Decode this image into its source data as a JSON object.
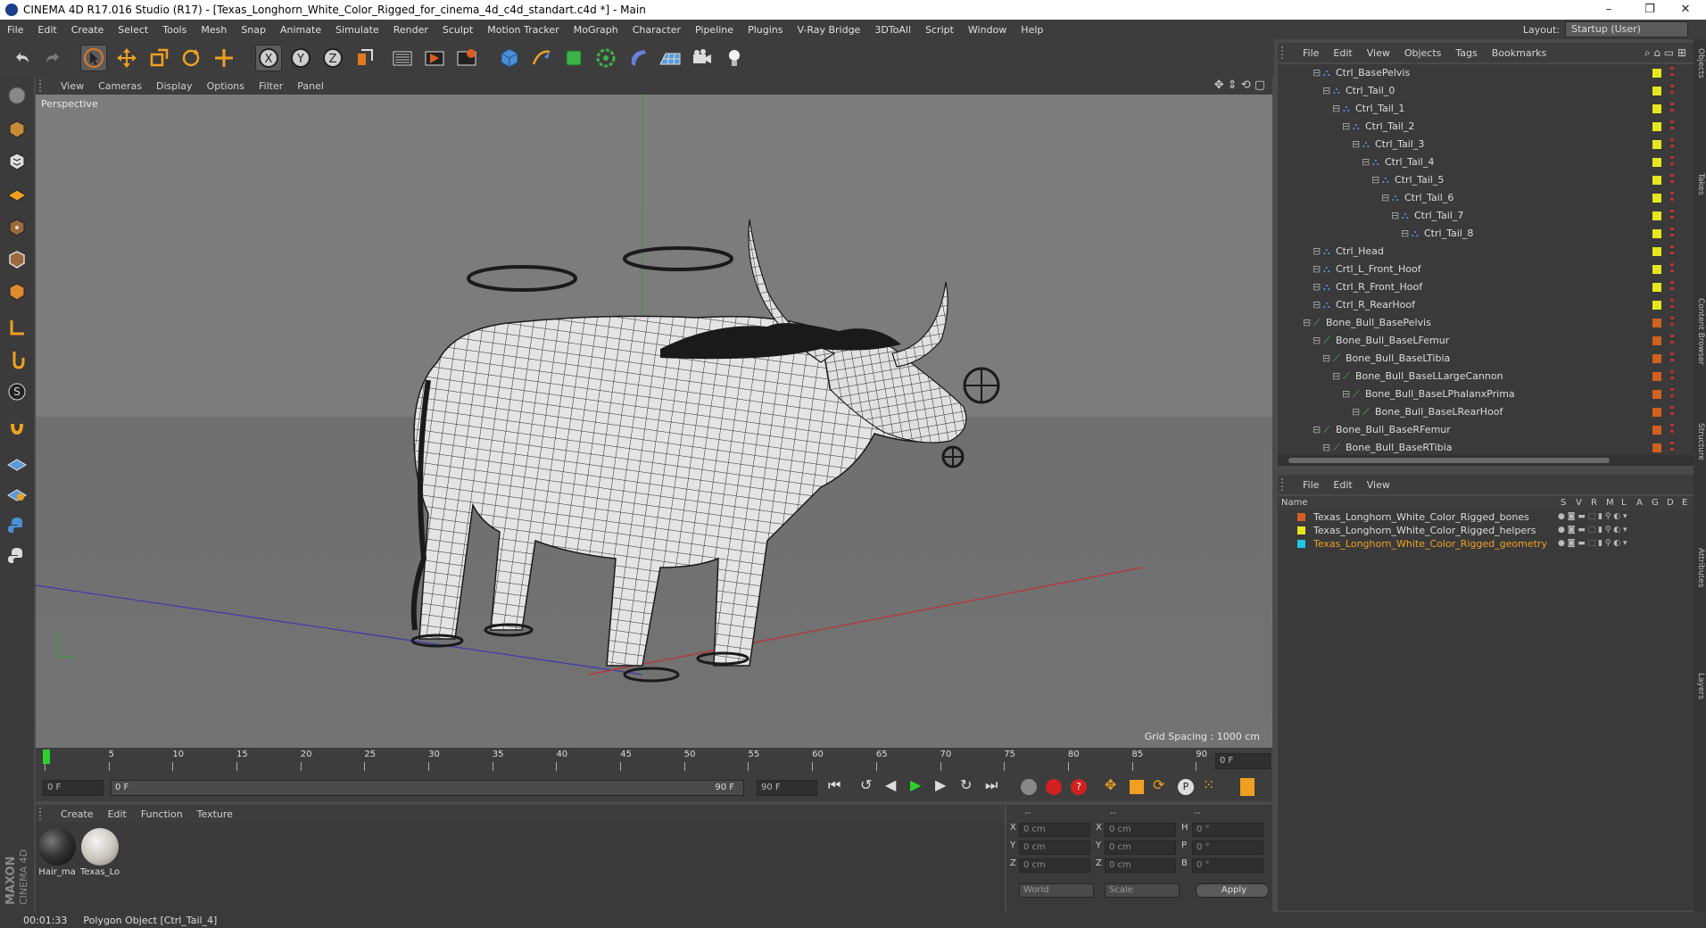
{
  "window": {
    "title": "CINEMA 4D R17.016 Studio (R17) - [Texas_Longhorn_White_Color_Rigged_for_cinema_4d_c4d_standart.c4d *] - Main",
    "controls": [
      "–",
      "❐",
      "✕"
    ]
  },
  "menubar": {
    "items": [
      "File",
      "Edit",
      "Create",
      "Select",
      "Tools",
      "Mesh",
      "Snap",
      "Animate",
      "Simulate",
      "Render",
      "Sculpt",
      "Motion Tracker",
      "MoGraph",
      "Character",
      "Pipeline",
      "Plugins",
      "V-Ray Bridge",
      "3DToAll",
      "Script",
      "Window",
      "Help"
    ],
    "layout_label": "Layout:",
    "layout_value": "Startup (User)"
  },
  "viewport": {
    "menu": [
      "View",
      "Cameras",
      "Display",
      "Options",
      "Filter",
      "Panel"
    ],
    "label": "Perspective",
    "grid_spacing": "Grid Spacing : 1000 cm"
  },
  "timeline": {
    "ticks": [
      "0",
      "5",
      "10",
      "15",
      "20",
      "25",
      "30",
      "35",
      "40",
      "45",
      "50",
      "55",
      "60",
      "65",
      "70",
      "75",
      "80",
      "85",
      "90"
    ],
    "current_frame": "0 F",
    "start_field": "0 F",
    "range_start": "0 F",
    "range_end": "90 F",
    "end_field": "90 F"
  },
  "material_manager": {
    "menu": [
      "Create",
      "Edit",
      "Function",
      "Texture"
    ],
    "materials": [
      {
        "label": "Hair_ma"
      },
      {
        "label": "Texas_Lo"
      }
    ]
  },
  "coordinates": {
    "header": [
      "--",
      "--",
      "--"
    ],
    "rows": [
      {
        "a": "X",
        "av": "0 cm",
        "b": "X",
        "bv": "0 cm",
        "c": "H",
        "cv": "0 °"
      },
      {
        "a": "Y",
        "av": "0 cm",
        "b": "Y",
        "bv": "0 cm",
        "c": "P",
        "cv": "0 °"
      },
      {
        "a": "Z",
        "av": "0 cm",
        "b": "Z",
        "bv": "0 cm",
        "c": "B",
        "cv": "0 °"
      }
    ],
    "world": "World",
    "scale": "Scale",
    "apply": "Apply"
  },
  "status": {
    "time": "00:01:33",
    "message": "Polygon Object [Ctrl_Tail_4]"
  },
  "object_manager": {
    "menu": [
      "File",
      "Edit",
      "View",
      "Objects",
      "Tags",
      "Bookmarks"
    ],
    "items": [
      {
        "name": "Ctrl_BasePelvis",
        "depth": 0,
        "kind": "ctrl"
      },
      {
        "name": "Ctrl_Tail_0",
        "depth": 1,
        "kind": "ctrl"
      },
      {
        "name": "Ctrl_Tail_1",
        "depth": 2,
        "kind": "ctrl"
      },
      {
        "name": "Ctrl_Tail_2",
        "depth": 3,
        "kind": "ctrl"
      },
      {
        "name": "Ctrl_Tail_3",
        "depth": 4,
        "kind": "ctrl"
      },
      {
        "name": "Ctrl_Tail_4",
        "depth": 5,
        "kind": "ctrl"
      },
      {
        "name": "Ctrl_Tail_5",
        "depth": 6,
        "kind": "ctrl"
      },
      {
        "name": "Ctrl_Tail_6",
        "depth": 7,
        "kind": "ctrl"
      },
      {
        "name": "Ctrl_Tail_7",
        "depth": 8,
        "kind": "ctrl"
      },
      {
        "name": "Ctrl_Tail_8",
        "depth": 9,
        "kind": "ctrl"
      },
      {
        "name": "Ctrl_Head",
        "depth": 0,
        "kind": "ctrl"
      },
      {
        "name": "Crtl_L_Front_Hoof",
        "depth": 0,
        "kind": "ctrl"
      },
      {
        "name": "Ctrl_R_Front_Hoof",
        "depth": 0,
        "kind": "ctrl"
      },
      {
        "name": "Ctrl_R_RearHoof",
        "depth": 0,
        "kind": "ctrl"
      },
      {
        "name": "Bone_Bull_BasePelvis",
        "depth": -1,
        "kind": "bone"
      },
      {
        "name": "Bone_Bull_BaseLFemur",
        "depth": 0,
        "kind": "bone"
      },
      {
        "name": "Bone_Bull_BaseLTibia",
        "depth": 1,
        "kind": "bone"
      },
      {
        "name": "Bone_Bull_BaseLLargeCannon",
        "depth": 2,
        "kind": "bone"
      },
      {
        "name": "Bone_Bull_BaseLPhalanxPrima",
        "depth": 3,
        "kind": "bone"
      },
      {
        "name": "Bone_Bull_BaseLRearHoof",
        "depth": 4,
        "kind": "bone"
      },
      {
        "name": "Bone_Bull_BaseRFemur",
        "depth": 0,
        "kind": "bone"
      },
      {
        "name": "Bone_Bull_BaseRTibia",
        "depth": 1,
        "kind": "bone"
      }
    ],
    "colors": {
      "ctrl": "#e6e61e",
      "bone": "#d2601e"
    }
  },
  "layer_manager": {
    "menu": [
      "File",
      "Edit",
      "View"
    ],
    "columns": [
      "Name",
      "S",
      "V",
      "R",
      "M",
      "L",
      "A",
      "G",
      "D",
      "E"
    ],
    "layers": [
      {
        "name": "Texas_Longhorn_White_Color_Rigged_bones",
        "color": "#d2601e",
        "selected": false
      },
      {
        "name": "Texas_Longhorn_White_Color_Rigged_helpers",
        "color": "#e6e61e",
        "selected": false
      },
      {
        "name": "Texas_Longhorn_White_Color_Rigged_geometry",
        "color": "#1ec8e6",
        "selected": true
      }
    ]
  },
  "side_tabs": [
    "Objects",
    "Takes",
    "Content Browser",
    "Structure",
    "Attributes",
    "Layers"
  ]
}
